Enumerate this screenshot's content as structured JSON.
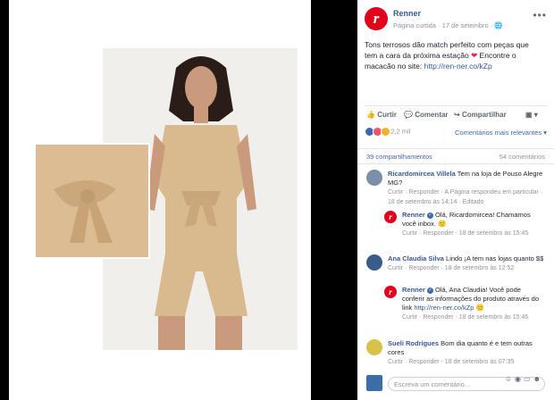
{
  "post": {
    "page_name": "Renner",
    "meta": "Página curtida · 17 de setembro · ",
    "text_before_heart": "Tons terrosos dão match perfeito com peças que tem a cara da próxima estação ",
    "text_after_heart": " Encontre o macacão no site: ",
    "link": "http://ren-ner.co/kZp",
    "more": "•••"
  },
  "actions": {
    "like": "Curtir",
    "comment": "Comentar",
    "share": "Compartilhar"
  },
  "reactions": {
    "count": "2,2 mil",
    "sort": "Comentários mais relevantes ▾",
    "shares": "39 compartilhamentos",
    "comments": "54 comentários"
  },
  "comments": [
    {
      "name": "Ricardomircea Villela",
      "text": " Tem na loja de Pouso Alegre MG?",
      "links": "Curtir · Responder · A Página respondeu em particular · 18 de setembro às 14:14 · Editado",
      "reply": {
        "name": "Renner",
        "text": " Olá, Ricardomircea! Chamamos você inbox. 🙂",
        "links": "Curtir · Responder · 18 de setembro às 15:45"
      }
    },
    {
      "name": "Ana Claudia Silva",
      "text": " Lindo ¡A tem nas lojas quanto $$",
      "links": "Curtir · Responder · 18 de setembro às 12:52",
      "reply": {
        "name": "Renner",
        "text": " Olá, Ana Claudia! Você pode conferir as informações do produto através do link ",
        "link": "http://ren-ner.co/kZp",
        "text2": " 🙂",
        "links": "Curtir · Responder · 18 de setembro às 15:46"
      }
    },
    {
      "name": "Sueli Rodrigues",
      "text": " Bom dia quanto é e tem outras cores",
      "links": "Curtir · Responder · 18 de setembro às 07:35"
    }
  ],
  "composer": {
    "placeholder": "Escreva um comentário..."
  }
}
